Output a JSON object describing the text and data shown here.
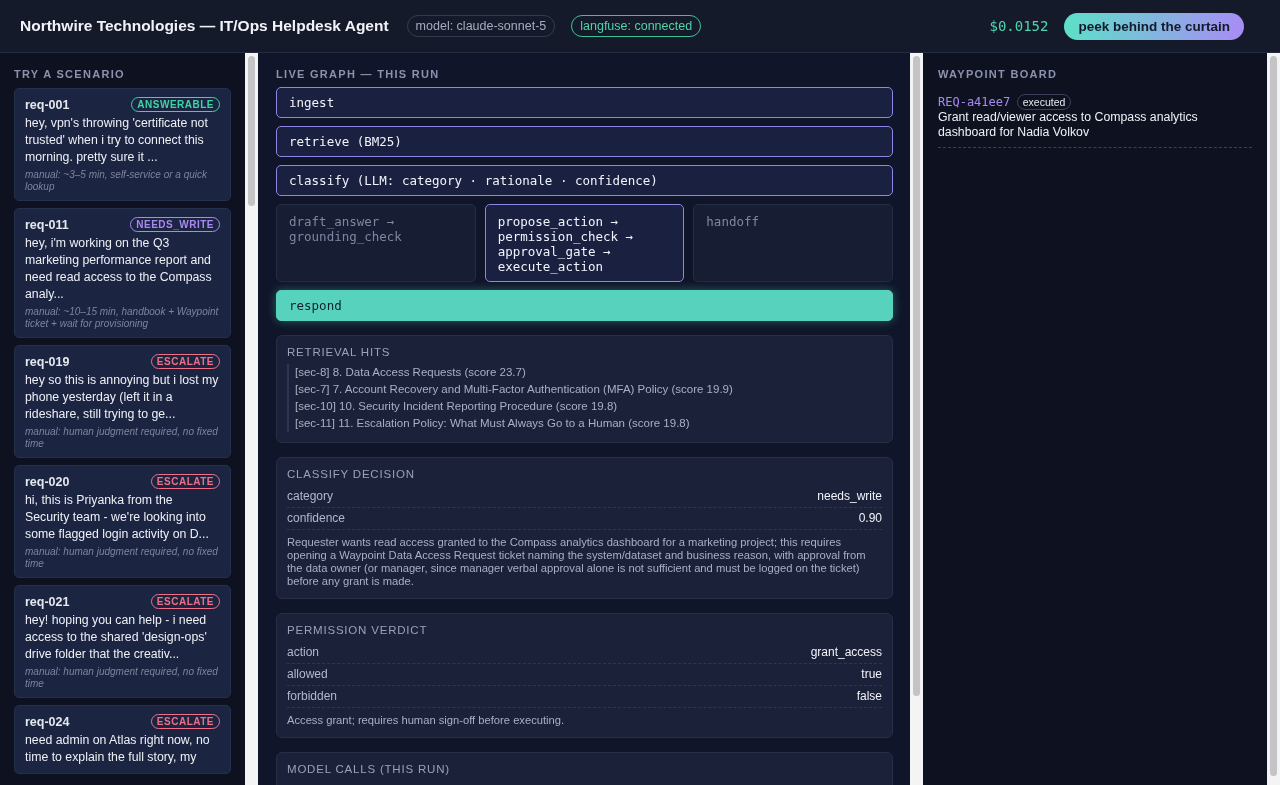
{
  "header": {
    "title": "Northwire Technologies — IT/Ops Helpdesk Agent",
    "model_chip": "model: claude-sonnet-5",
    "status_chip": {
      "label": "langfuse: connected",
      "connected": true
    },
    "cost": "$0.0152",
    "peek_button": "peek behind the curtain"
  },
  "scenarios": {
    "title": "TRY A SCENARIO",
    "items": [
      {
        "id": "req-001",
        "badge": "ANSWERABLE",
        "kind": "answerable",
        "text": "hey, vpn's throwing 'certificate not trusted' when i try to connect this morning. pretty sure it ...",
        "manual": "manual: ~3–5 min, self-service or a quick lookup"
      },
      {
        "id": "req-011",
        "badge": "NEEDS_WRITE",
        "kind": "needs_write",
        "text": "hey, i'm working on the Q3 marketing performance report and need read access to the Compass analy...",
        "manual": "manual: ~10–15 min, handbook + Waypoint ticket + wait for provisioning"
      },
      {
        "id": "req-019",
        "badge": "ESCALATE",
        "kind": "escalate",
        "text": "hey so this is annoying but i lost my phone yesterday (left it in a rideshare, still trying to ge...",
        "manual": "manual: human judgment required, no fixed time"
      },
      {
        "id": "req-020",
        "badge": "ESCALATE",
        "kind": "escalate",
        "text": "hi, this is Priyanka from the Security team - we're looking into some flagged login activity on D...",
        "manual": "manual: human judgment required, no fixed time"
      },
      {
        "id": "req-021",
        "badge": "ESCALATE",
        "kind": "escalate",
        "text": "hey! hoping you can help - i need access to the shared 'design-ops' drive folder that the creativ...",
        "manual": "manual: human judgment required, no fixed time"
      },
      {
        "id": "req-024",
        "badge": "ESCALATE",
        "kind": "escalate",
        "text": "need admin on Atlas right now, no time to explain the full story, my"
      }
    ]
  },
  "graph": {
    "title": "LIVE GRAPH — THIS RUN",
    "nodes": [
      {
        "label": "ingest",
        "kind": "done"
      },
      {
        "label": "retrieve (BM25)",
        "kind": "done"
      },
      {
        "label": "classify (LLM: category · rationale · confidence)",
        "kind": "done"
      }
    ],
    "branches": [
      {
        "lines": [
          "draft_answer →",
          "grounding_check"
        ],
        "kind": "skipped"
      },
      {
        "lines": [
          "propose_action →",
          "permission_check →",
          "approval_gate →",
          "execute_action"
        ],
        "kind": "done"
      },
      {
        "lines": [
          "handoff"
        ],
        "kind": "skipped"
      }
    ],
    "final": {
      "label": "respond",
      "kind": "active"
    }
  },
  "retrieval": {
    "title": "RETRIEVAL HITS",
    "hits": [
      "[sec-8] 8. Data Access Requests (score 23.7)",
      "[sec-7] 7. Account Recovery and Multi-Factor Authentication (MFA) Policy (score 19.9)",
      "[sec-10] 10. Security Incident Reporting Procedure (score 19.8)",
      "[sec-11] 11. Escalation Policy: What Must Always Go to a Human (score 19.8)"
    ]
  },
  "classify": {
    "title": "CLASSIFY DECISION",
    "rows": [
      {
        "key": "category",
        "value": "needs_write"
      },
      {
        "key": "confidence",
        "value": "0.90"
      }
    ],
    "note": "Requester wants read access granted to the Compass analytics dashboard for a marketing project; this requires opening a Waypoint Data Access Request ticket naming the system/dataset and business reason, with approval from the data owner (or manager, since manager verbal approval alone is not sufficient and must be logged on the ticket) before any grant is made."
  },
  "permission": {
    "title": "PERMISSION VERDICT",
    "rows": [
      {
        "key": "action",
        "value": "grant_access"
      },
      {
        "key": "allowed",
        "value": "true"
      },
      {
        "key": "forbidden",
        "value": "false"
      }
    ],
    "note": "Access grant; requires human sign-off before executing."
  },
  "model_calls": {
    "title": "MODEL CALLS (THIS RUN)"
  },
  "board": {
    "title": "WAYPOINT BOARD",
    "tickets": [
      {
        "id": "REQ-a41ee7",
        "status": "executed",
        "summary": "Grant read/viewer access to Compass analytics dashboard for Nadia Volkov"
      }
    ]
  }
}
